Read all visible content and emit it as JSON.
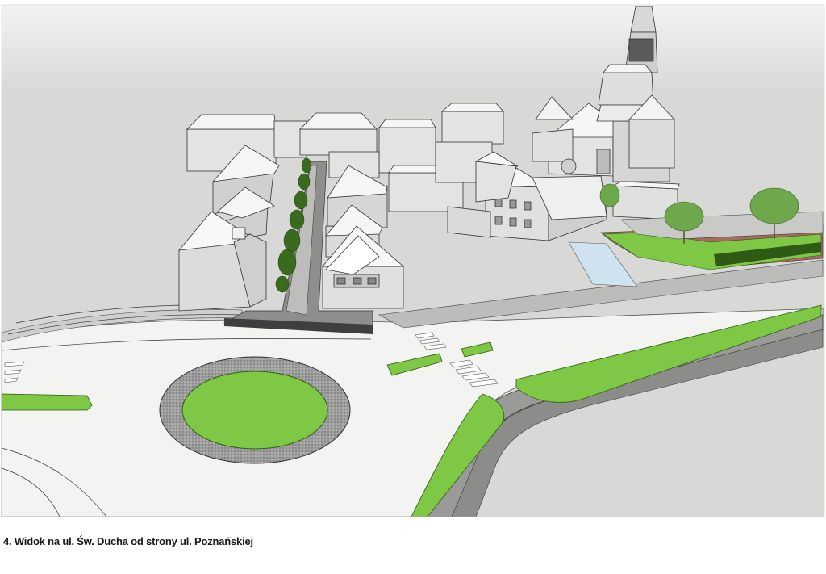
{
  "caption": "4. Widok na ul. Św. Ducha od strony ul. Poznańskiej",
  "colors": {
    "sky": "#dedede",
    "ground": "#d9d9d7",
    "road": "#f4f4f2",
    "grass": "#7ec845",
    "asphalt": "#8a8a8a",
    "building": "#e2e2e2",
    "roof": "#f7f7f7"
  }
}
